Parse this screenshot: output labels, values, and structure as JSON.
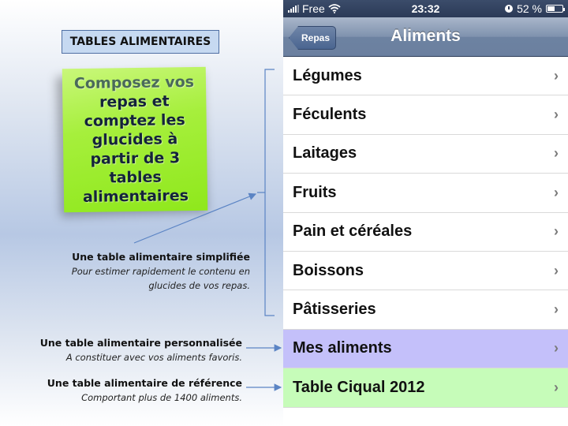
{
  "slide": {
    "title": "TABLES ALIMENTAIRES",
    "sticky_note_lines": [
      "Composez vos",
      "repas et",
      "comptez les",
      "glucides à",
      "partir de 3",
      "tables",
      "alimentaires"
    ],
    "sticky_color": "#9fee33",
    "descriptions": [
      {
        "heading": "Une table alimentaire simplifiée",
        "lines": [
          "Pour estimer rapidement le contenu en",
          "glucides de vos repas."
        ]
      },
      {
        "heading": "Une table alimentaire personnalisée",
        "lines": [
          "A constituer avec vos aliments favoris."
        ]
      },
      {
        "heading": "Une table alimentaire de référence",
        "lines": [
          "Comportant plus de 1400 aliments."
        ]
      }
    ],
    "arrow_color": "#5b84c4"
  },
  "phone": {
    "status_bar": {
      "carrier": "Free",
      "time": "23:32",
      "battery": "52 %",
      "battery_level": 0.52
    },
    "nav": {
      "back_label": "Repas",
      "title": "Aliments"
    },
    "items": [
      {
        "label": "Légumes",
        "style": "plain"
      },
      {
        "label": "Féculents",
        "style": "plain"
      },
      {
        "label": "Laitages",
        "style": "plain"
      },
      {
        "label": "Fruits",
        "style": "plain"
      },
      {
        "label": "Pain et céréales",
        "style": "plain"
      },
      {
        "label": "Boissons",
        "style": "plain"
      },
      {
        "label": "Pâtisseries",
        "style": "plain"
      },
      {
        "label": "Mes aliments",
        "style": "purple"
      },
      {
        "label": "Table Ciqual 2012",
        "style": "green"
      }
    ],
    "chevron": "›"
  }
}
